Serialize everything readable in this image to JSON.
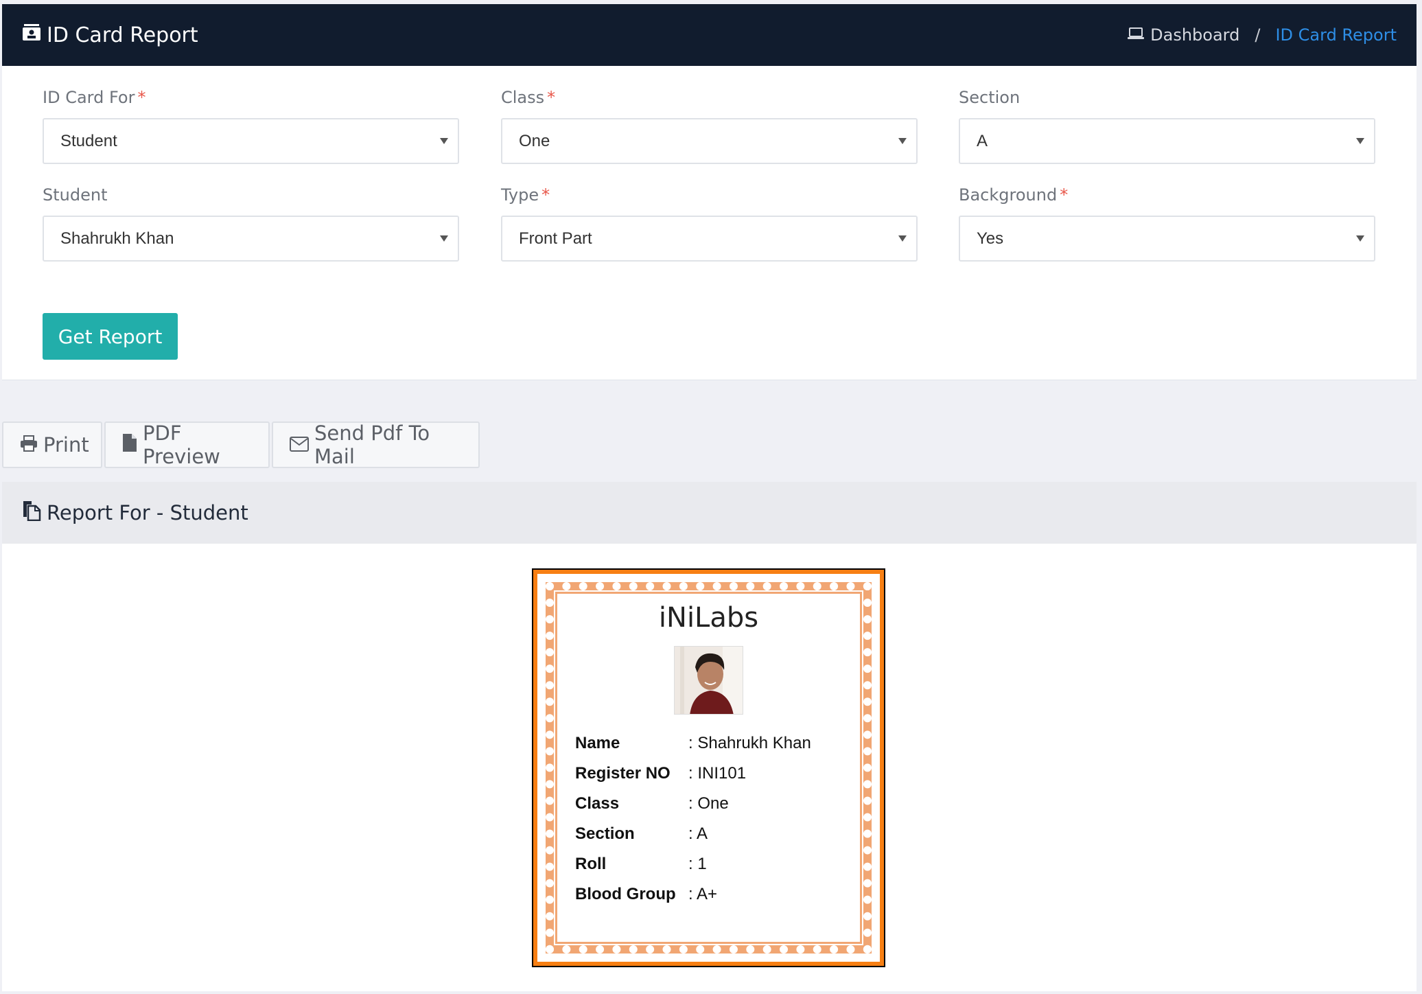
{
  "header": {
    "title": "ID Card Report",
    "breadcrumb": {
      "home": "Dashboard",
      "separator": "/",
      "current": "ID Card Report"
    }
  },
  "filters": [
    {
      "label": "ID Card For",
      "required": true,
      "value": "Student"
    },
    {
      "label": "Class",
      "required": true,
      "value": "One"
    },
    {
      "label": "Section",
      "required": false,
      "value": "A"
    },
    {
      "label": "Student",
      "required": false,
      "value": "Shahrukh Khan"
    },
    {
      "label": "Type",
      "required": true,
      "value": "Front Part"
    },
    {
      "label": "Background",
      "required": true,
      "value": "Yes"
    }
  ],
  "required_marker": "*",
  "get_report_label": "Get Report",
  "actions": {
    "print": "Print",
    "pdf": "PDF Preview",
    "mail": "Send Pdf To Mail"
  },
  "report": {
    "title": "Report For - Student"
  },
  "id_card": {
    "org": "iNiLabs",
    "fields": [
      {
        "label": "Name",
        "value": "Shahrukh Khan"
      },
      {
        "label": "Register NO",
        "value": "INI101"
      },
      {
        "label": "Class",
        "value": "One"
      },
      {
        "label": "Section",
        "value": "A"
      },
      {
        "label": "Roll",
        "value": "1"
      },
      {
        "label": "Blood Group",
        "value": "A+"
      }
    ]
  },
  "colors": {
    "accent": "#22aeaa",
    "link": "#2e8ee6",
    "header_bg": "#111c2e",
    "card_border": "#f77f13"
  }
}
